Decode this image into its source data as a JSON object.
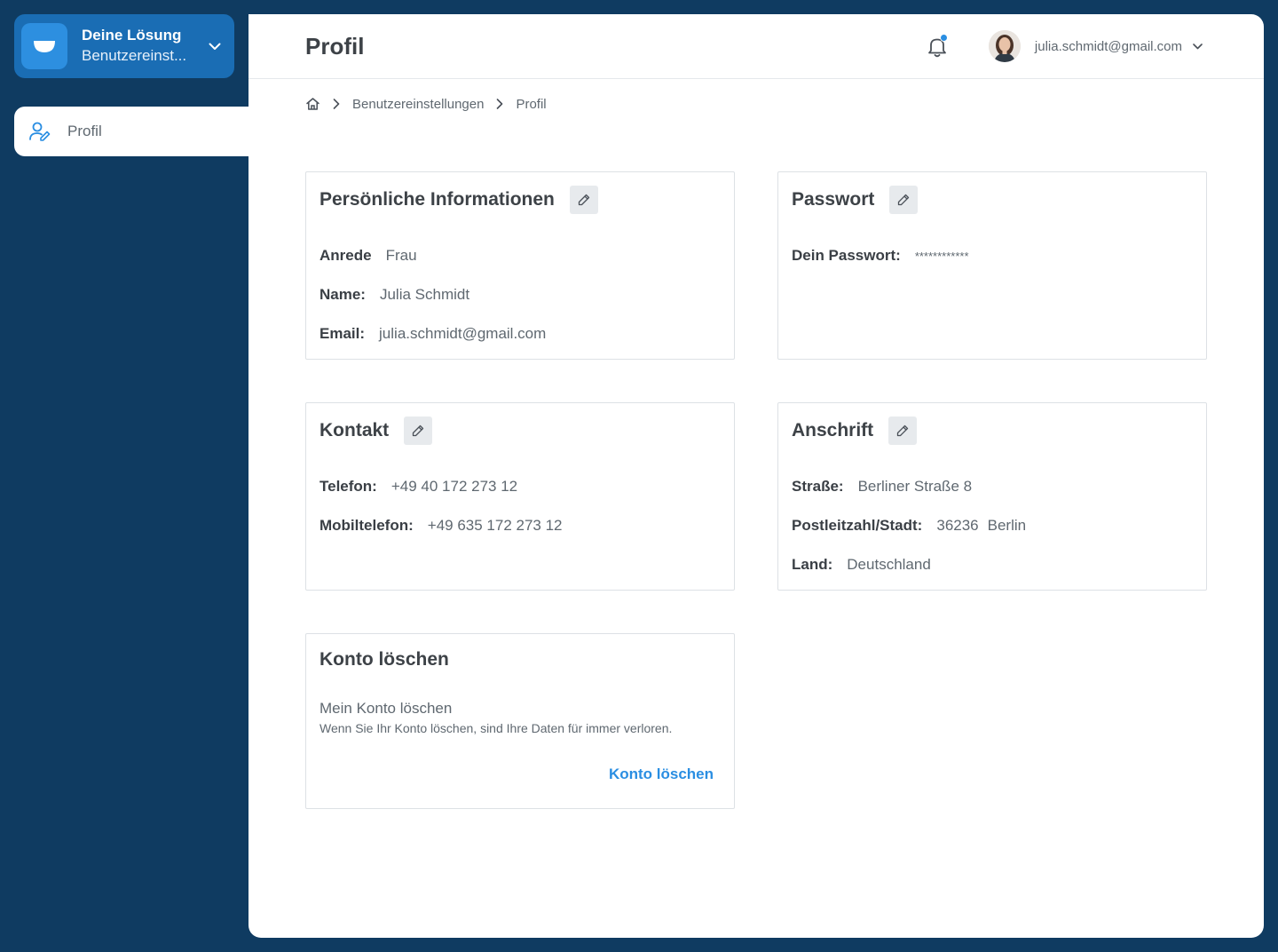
{
  "sidebar": {
    "brand_title": "Deine Lösung",
    "brand_subtitle": "Benutzereinst...",
    "items": [
      {
        "label": "Profil",
        "icon": "user-edit-icon"
      }
    ]
  },
  "header": {
    "title": "Profil",
    "user_email": "julia.schmidt@gmail.com"
  },
  "breadcrumb": {
    "items": [
      "Benutzereinstellungen",
      "Profil"
    ]
  },
  "cards": {
    "personal": {
      "title": "Persönliche Informationen",
      "salutation_label": "Anrede",
      "salutation_value": "Frau",
      "name_label": "Name:",
      "name_value": "Julia Schmidt",
      "email_label": "Email:",
      "email_value": "julia.schmidt@gmail.com"
    },
    "password": {
      "title": "Passwort",
      "label": "Dein Passwort:",
      "value": "************"
    },
    "contact": {
      "title": "Kontakt",
      "phone_label": "Telefon:",
      "phone_value": "+49 40 172 273 12",
      "mobile_label": "Mobiltelefon:",
      "mobile_value": "+49 635 172 273 12"
    },
    "address": {
      "title": "Anschrift",
      "street_label": "Straße:",
      "street_value": "Berliner Straße 8",
      "zip_city_label": "Postleitzahl/Stadt:",
      "zip_value": "36236",
      "city_value": "Berlin",
      "country_label": "Land:",
      "country_value": "Deutschland"
    },
    "delete": {
      "title": "Konto löschen",
      "subtitle": "Mein Konto löschen",
      "description": "Wenn Sie Ihr Konto löschen, sind Ihre Daten für immer verloren.",
      "action": "Konto löschen"
    }
  },
  "colors": {
    "background": "#0f3b61",
    "brand": "#1a6db4",
    "accent": "#2a8ee2"
  }
}
